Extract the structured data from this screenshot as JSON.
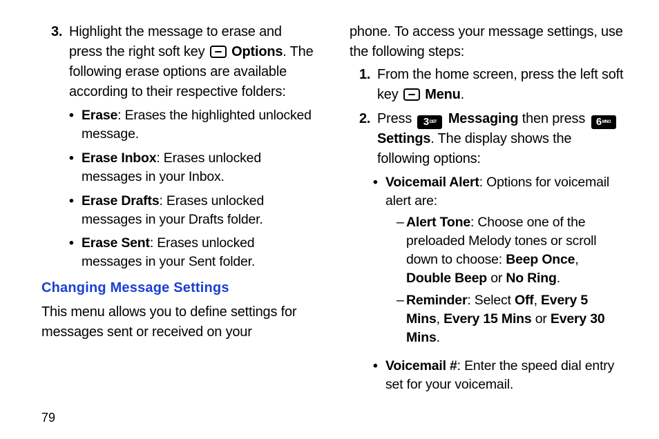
{
  "page_number": "79",
  "left": {
    "step3_num": "3.",
    "step3_pre": "Highlight the message to erase and press the right soft key ",
    "step3_optlabel": "Options",
    "step3_post": ". The following erase options are available according to their respective folders:",
    "bullets": [
      {
        "bold": "Erase",
        "rest": ": Erases the highlighted unlocked message."
      },
      {
        "bold": "Erase Inbox",
        "rest": ": Erases unlocked messages in your Inbox."
      },
      {
        "bold": "Erase Drafts",
        "rest": ": Erases unlocked messages in your Drafts folder."
      },
      {
        "bold": "Erase Sent",
        "rest": ": Erases unlocked messages in your Sent folder."
      }
    ],
    "heading": "Changing Message Settings",
    "intro": "This menu allows you to define settings for messages sent or received on your"
  },
  "right": {
    "intro_cont": "phone. To access your message settings, use the following steps:",
    "step1_num": "1.",
    "step1_pre": "From the home screen, press the left soft key ",
    "step1_menulabel": "Menu",
    "step1_post": ".",
    "step2_num": "2.",
    "step2_press": "Press ",
    "key3_digit": "3",
    "key3_letters": "DEF",
    "step2_messaging": "Messaging",
    "step2_then": " then press ",
    "key6_digit": "6",
    "key6_letters": "MNO",
    "step2_settings": "Settings",
    "step2_tail": ". The display shows the following options:",
    "vm_alert_bold": "Voicemail Alert",
    "vm_alert_rest": ": Options for voicemail alert are:",
    "alert_tone_bold": "Alert Tone",
    "alert_tone_rest1": ": Choose one of the preloaded Melody tones or scroll down to choose: ",
    "beep_once": "Beep Once",
    "comma1": ", ",
    "double_beep": "Double Beep",
    "or1": " or ",
    "no_ring": "No Ring",
    "period1": ".",
    "reminder_bold": "Reminder",
    "reminder_pre": ": Select ",
    "off": "Off",
    "comma2": ", ",
    "e5": "Every 5 Mins",
    "comma3": ", ",
    "e15": "Every 15 Mins",
    "or2": " or ",
    "e30": "Every 30 Mins",
    "period2": ".",
    "vm_num_bold": "Voicemail #",
    "vm_num_rest": ": Enter the speed dial entry set for your voicemail."
  }
}
